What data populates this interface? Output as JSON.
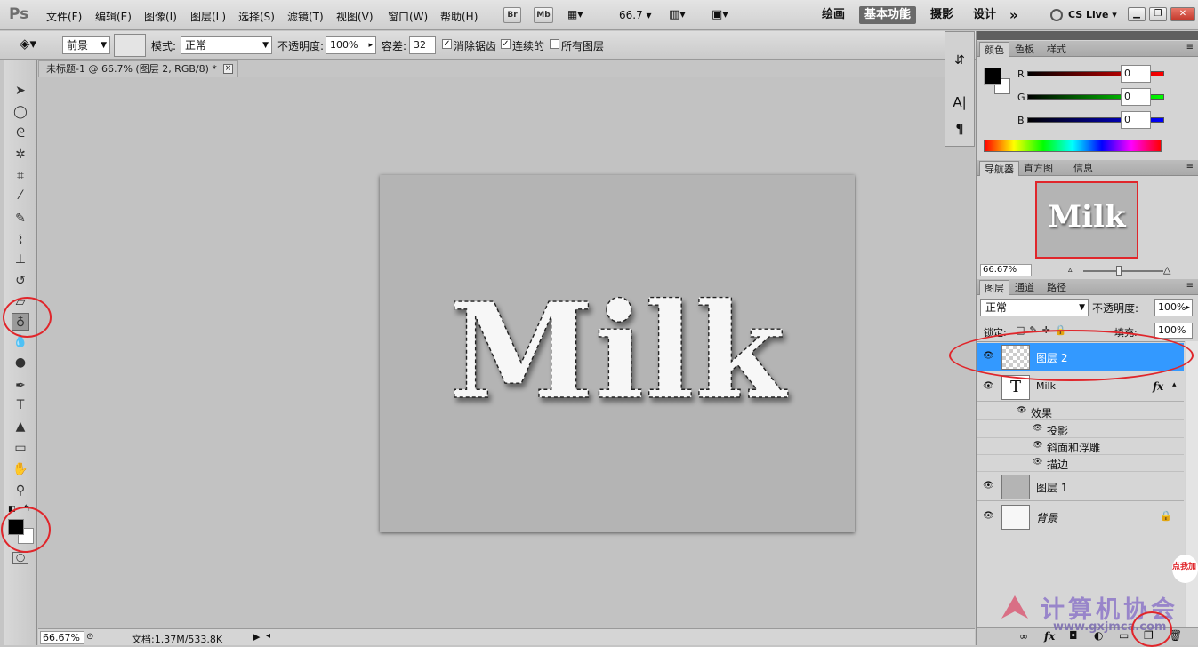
{
  "app": {
    "logo": "Ps"
  },
  "menu": [
    "文件(F)",
    "编辑(E)",
    "图像(I)",
    "图层(L)",
    "选择(S)",
    "滤镜(T)",
    "视图(V)",
    "窗口(W)",
    "帮助(H)"
  ],
  "toolbar_top": {
    "bridge": "Br",
    "mini_bridge": "Mb",
    "zoom": "66.7"
  },
  "workspaces": [
    "绘画",
    "基本功能",
    "摄影",
    "设计"
  ],
  "cslive": "CS Live",
  "options": {
    "fill_source": "前景",
    "mode_label": "模式:",
    "mode_value": "正常",
    "opacity_label": "不透明度:",
    "opacity_value": "100%",
    "tolerance_label": "容差:",
    "tolerance_value": "32",
    "antialias": "消除锯齿",
    "contiguous": "连续的",
    "all_layers": "所有图层"
  },
  "document": {
    "tab_title": "未标题-1 @ 66.7% (图层 2, RGB/8) *",
    "text": "Milk"
  },
  "status": {
    "zoom": "66.67%",
    "doc_size": "文档:1.37M/533.8K"
  },
  "color_panel": {
    "tabs": [
      "颜色",
      "色板",
      "样式"
    ],
    "r_label": "R",
    "g_label": "G",
    "b_label": "B",
    "r": "0",
    "g": "0",
    "b": "0"
  },
  "navigator_panel": {
    "tabs": [
      "导航器",
      "直方图",
      "信息"
    ],
    "zoom": "66.67%",
    "preview_text": "Milk"
  },
  "layers_panel": {
    "tabs": [
      "图层",
      "通道",
      "路径"
    ],
    "blend_mode": "正常",
    "opacity_label": "不透明度:",
    "opacity": "100%",
    "lock_label": "锁定:",
    "fill_label": "填充:",
    "fill": "100%",
    "layers": [
      {
        "name": "图层 2",
        "selected": true
      },
      {
        "name": "Milk",
        "fx": "fx"
      },
      {
        "name": "图层 1"
      },
      {
        "name": "背景"
      }
    ],
    "effects_label": "效果",
    "effects": [
      "投影",
      "斜面和浮雕",
      "描边"
    ]
  },
  "watermark": {
    "text": "计算机协会",
    "url": "www.gxjmca.com",
    "badge": "点我加"
  },
  "colors": {
    "accent": "#3399ff",
    "annotation": "#e0262b"
  }
}
